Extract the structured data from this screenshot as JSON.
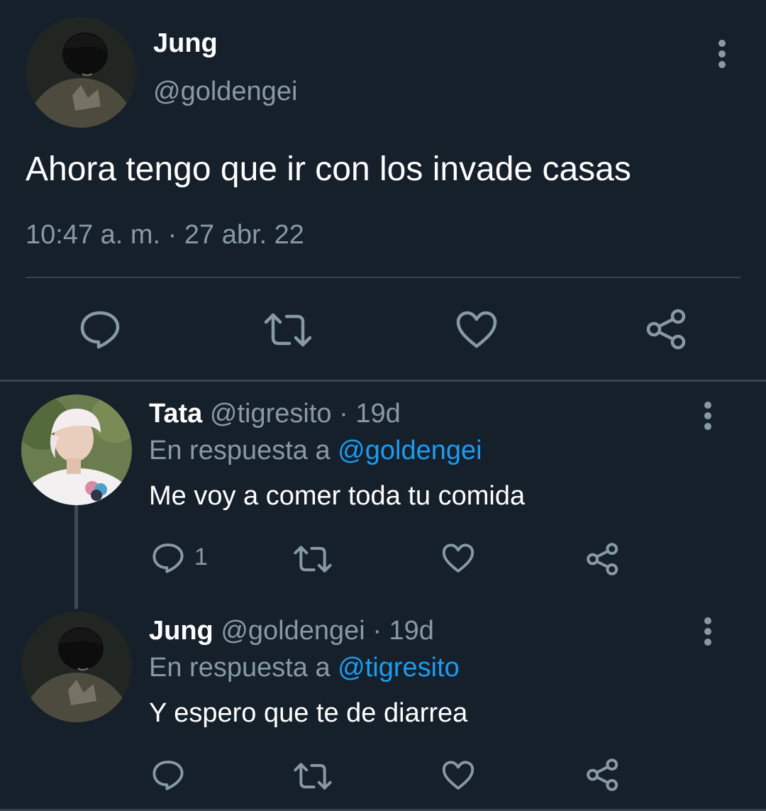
{
  "main_tweet": {
    "author_name": "Jung",
    "author_handle": "@goldengei",
    "text": "Ahora tengo que ir con los invade casas",
    "timestamp": "10:47 a. m. · 27 abr. 22"
  },
  "replies": [
    {
      "author_name": "Tata",
      "author_handle": "@tigresito",
      "separator": "·",
      "time": "19d",
      "reply_prefix": "En respuesta a",
      "reply_to": "@goldengei",
      "text": "Me voy a comer toda tu comida",
      "reply_count": "1"
    },
    {
      "author_name": "Jung",
      "author_handle": "@goldengei",
      "separator": "·",
      "time": "19d",
      "reply_prefix": "En respuesta a",
      "reply_to": "@tigresito",
      "text": "Y espero que te de diarrea",
      "reply_count": ""
    }
  ],
  "icons": {
    "reply": "comment-bubble-icon",
    "retweet": "retweet-icon",
    "like": "heart-icon",
    "share": "share-icon",
    "more": "more-vertical-icon"
  },
  "colors": {
    "background": "#15202b",
    "text_primary": "#ffffff",
    "text_secondary": "#8899a6",
    "link": "#1d9bf0",
    "divider": "#38444d"
  }
}
